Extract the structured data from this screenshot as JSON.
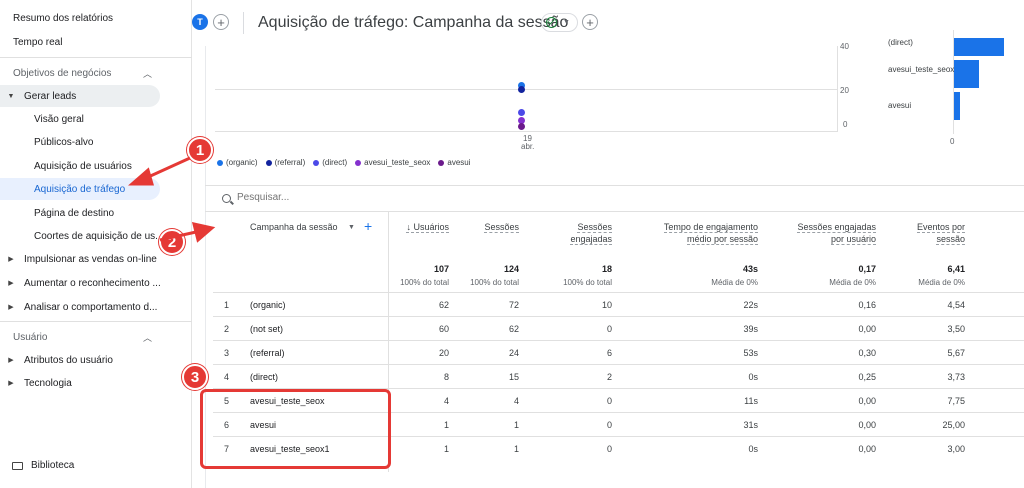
{
  "sidebar": {
    "top_items": [
      "Resumo dos relatórios",
      "Tempo real"
    ],
    "group_business": "Objetivos de negócios",
    "gerar_leads": "Gerar leads",
    "sub_items": [
      "Visão geral",
      "Públicos-alvo",
      "Aquisição de usuários",
      "Aquisição de tráfego",
      "Página de destino",
      "Coortes de aquisição de us..."
    ],
    "collapsed_items": [
      "Impulsionar as vendas on-line",
      "Aumentar o reconhecimento ...",
      "Analisar o comportamento d..."
    ],
    "group_user": "Usuário",
    "user_items": [
      "Atributos do usuário",
      "Tecnologia"
    ],
    "library": "Biblioteca"
  },
  "header": {
    "avatar_letter": "T",
    "title": "Aquisição de tráfego: Campanha da sessão"
  },
  "chart_data": [
    {
      "type": "scatter",
      "x_tick": [
        "19",
        "abr."
      ],
      "y_ticks": [
        "40",
        "20",
        "0"
      ],
      "legend": [
        "(organic)",
        "(referral)",
        "(direct)",
        "avesui_teste_seox",
        "avesui"
      ],
      "colors": [
        "#1a73e8",
        "#12239e",
        "#4b49e8",
        "#8430ce",
        "#6b1a8c"
      ],
      "values": [
        62,
        20,
        8,
        4,
        1
      ]
    },
    {
      "type": "bar",
      "categories": [
        "(direct)",
        "avesui_teste_seox",
        "avesui"
      ],
      "values": [
        8,
        4,
        1
      ],
      "x_ticks": [
        "0"
      ]
    }
  ],
  "search": {
    "placeholder": "Pesquisar..."
  },
  "table": {
    "dimension_header": "Campanha da sessão",
    "columns": [
      {
        "label1": "↓ Usuários",
        "label2": "",
        "total": "107",
        "total_sub": "100% do total"
      },
      {
        "label1": "Sessões",
        "label2": "",
        "total": "124",
        "total_sub": "100% do total"
      },
      {
        "label1": "Sessões",
        "label2": "engajadas",
        "total": "18",
        "total_sub": "100% do total"
      },
      {
        "label1": "Tempo de engajamento",
        "label2": "médio por sessão",
        "total": "43s",
        "total_sub": "Média de 0%"
      },
      {
        "label1": "Sessões engajadas",
        "label2": "por usuário",
        "total": "0,17",
        "total_sub": "Média de 0%"
      },
      {
        "label1": "Eventos por",
        "label2": "sessão",
        "total": "6,41",
        "total_sub": "Média de 0%"
      }
    ],
    "rows": [
      {
        "idx": "1",
        "name": "(organic)",
        "cells": [
          "62",
          "72",
          "10",
          "22s",
          "0,16",
          "4,54"
        ]
      },
      {
        "idx": "2",
        "name": "(not set)",
        "cells": [
          "60",
          "62",
          "0",
          "39s",
          "0,00",
          "3,50"
        ]
      },
      {
        "idx": "3",
        "name": "(referral)",
        "cells": [
          "20",
          "24",
          "6",
          "53s",
          "0,30",
          "5,67"
        ]
      },
      {
        "idx": "4",
        "name": "(direct)",
        "cells": [
          "8",
          "15",
          "2",
          "0s",
          "0,25",
          "3,73"
        ]
      },
      {
        "idx": "5",
        "name": "avesui_teste_seox",
        "cells": [
          "4",
          "4",
          "0",
          "11s",
          "0,00",
          "7,75"
        ]
      },
      {
        "idx": "6",
        "name": "avesui",
        "cells": [
          "1",
          "1",
          "0",
          "31s",
          "0,00",
          "25,00"
        ]
      },
      {
        "idx": "7",
        "name": "avesui_teste_seox1",
        "cells": [
          "1",
          "1",
          "0",
          "0s",
          "0,00",
          "3,00"
        ]
      }
    ]
  },
  "annotations": [
    "1",
    "2",
    "3"
  ],
  "annotation_color": "#e53935",
  "accent_color": "#1a73e8"
}
